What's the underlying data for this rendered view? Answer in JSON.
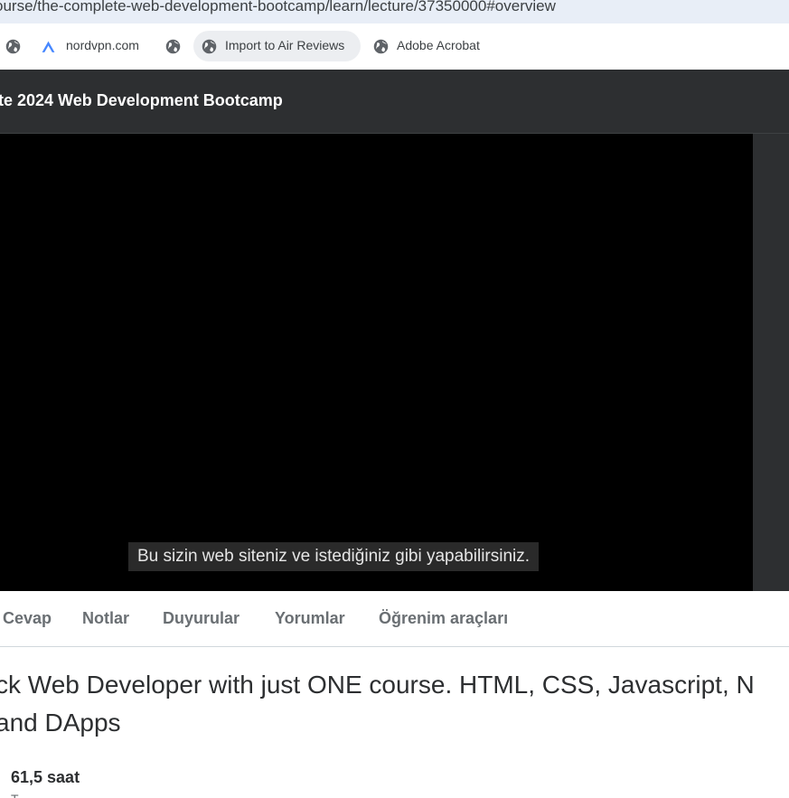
{
  "browser": {
    "url": "ourse/the-complete-web-development-bootcamp/learn/lecture/37350000#overview",
    "bookmarks": [
      {
        "label": "",
        "icon": "globe-icon"
      },
      {
        "label": "nordvpn.com",
        "icon": "nordvpn-icon"
      },
      {
        "label": "",
        "icon": "globe-icon"
      },
      {
        "label": "Import to Air Reviews",
        "icon": "globe-icon"
      },
      {
        "label": "Adobe Acrobat",
        "icon": "globe-icon"
      }
    ]
  },
  "course": {
    "title": "te 2024 Web Development Bootcamp"
  },
  "video": {
    "subtitle": "Bu sizin web siteniz ve istediğiniz gibi yapabilirsiniz."
  },
  "tabs": [
    "Cevap",
    "Notlar",
    "Duyurular",
    "Yorumlar",
    "Öğrenim araçları"
  ],
  "overview": {
    "headline_line1": "ck Web Developer with just ONE course. HTML, CSS, Javascript, N",
    "headline_line2": " and DApps",
    "stat_value": "61,5 saat",
    "stat_label": "T"
  },
  "colors": {
    "header_bg": "#2d2f31",
    "tab_text": "#6a6f73",
    "nordvpn_blue": "#4687ff"
  }
}
